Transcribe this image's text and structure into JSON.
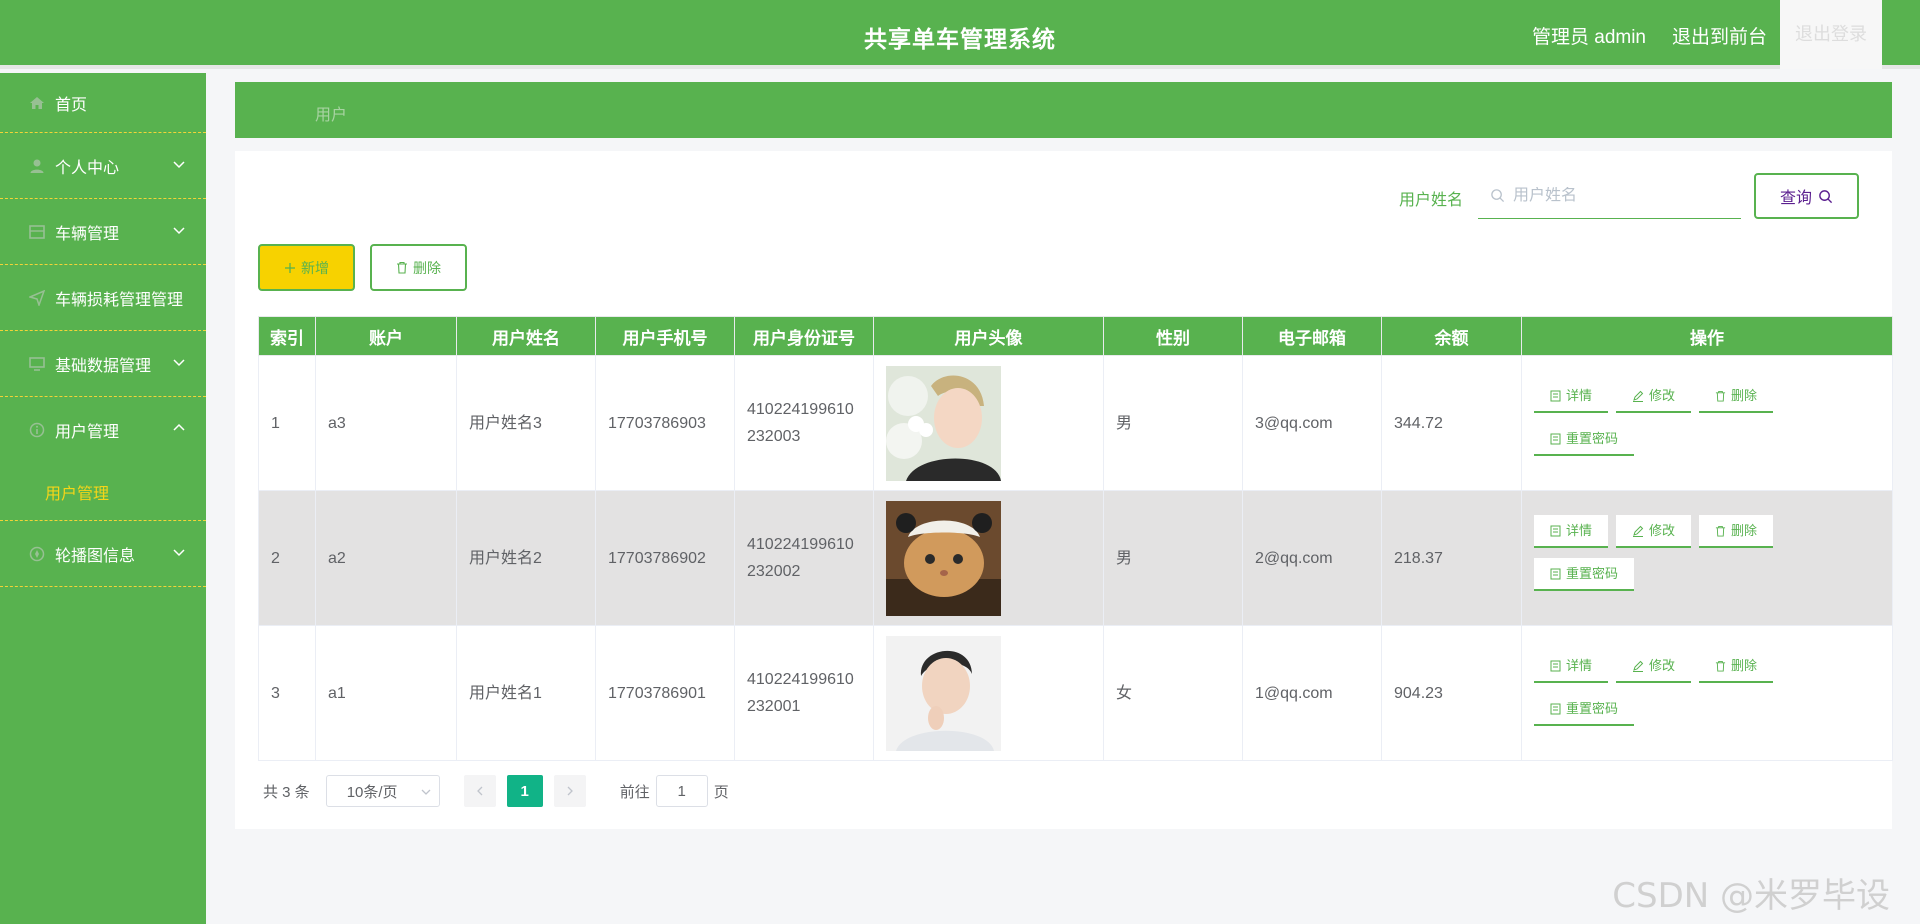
{
  "header": {
    "title": "共享单车管理系统",
    "user": "管理员 admin",
    "front": "退出到前台",
    "logout": "退出登录"
  },
  "sidebar": {
    "items": [
      {
        "label": "首页",
        "icon": "home-icon"
      },
      {
        "label": "个人中心",
        "icon": "user-icon"
      },
      {
        "label": "车辆管理",
        "icon": "grid-icon"
      },
      {
        "label": "车辆损耗管理管理",
        "icon": "send-icon"
      },
      {
        "label": "基础数据管理",
        "icon": "monitor-icon"
      },
      {
        "label": "用户管理",
        "icon": "info-icon"
      },
      {
        "label": "轮播图信息",
        "icon": "compass-icon"
      }
    ],
    "sub_active": "用户管理"
  },
  "breadcrumb": "用户",
  "search": {
    "label": "用户姓名",
    "placeholder": "用户姓名",
    "button": "查询"
  },
  "actions": {
    "add": "新增",
    "delete": "删除"
  },
  "table": {
    "columns": [
      "索引",
      "账户",
      "用户姓名",
      "用户手机号",
      "用户身份证号",
      "用户头像",
      "性别",
      "电子邮箱",
      "余额",
      "操作"
    ],
    "rows": [
      {
        "index": "1",
        "account": "a3",
        "name": "用户姓名3",
        "phone": "17703786903",
        "id_a": "410224199610",
        "id_b": "232003",
        "avatar": "avatar-photo",
        "gender": "男",
        "email": "3@qq.com",
        "balance": "344.72"
      },
      {
        "index": "2",
        "account": "a2",
        "name": "用户姓名2",
        "phone": "17703786902",
        "id_a": "410224199610",
        "id_b": "232002",
        "avatar": "cat-photo",
        "gender": "男",
        "email": "2@qq.com",
        "balance": "218.37"
      },
      {
        "index": "3",
        "account": "a1",
        "name": "用户姓名1",
        "phone": "17703786901",
        "id_a": "410224199610",
        "id_b": "232001",
        "avatar": "avatar-photo",
        "gender": "女",
        "email": "1@qq.com",
        "balance": "904.23"
      }
    ],
    "ops": {
      "detail": "详情",
      "edit": "修改",
      "delete": "删除",
      "reset": "重置密码"
    }
  },
  "pagination": {
    "total": "共 3 条",
    "page_size": "10条/页",
    "current": "1",
    "goto_prefix": "前往",
    "goto_value": "1",
    "goto_suffix": "页"
  },
  "watermark": "CSDN @米罗毕设",
  "colors": {
    "primary": "#58b24f",
    "accent": "#f7d200",
    "page_active": "#11b387"
  }
}
